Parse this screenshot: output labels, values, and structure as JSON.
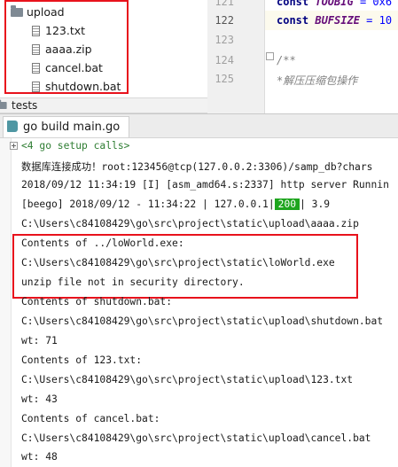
{
  "project_tree": {
    "folder": "upload",
    "files": [
      "123.txt",
      "aaaa.zip",
      "cancel.bat",
      "shutdown.bat"
    ],
    "next_folder": "tests"
  },
  "editor": {
    "lines": [
      {
        "number": "121",
        "keyword": "const",
        "name": "TOOBIG",
        "rest": " = 0x6"
      },
      {
        "number": "122",
        "keyword": "const",
        "name": "BUFSIZE",
        "rest": " = 10"
      },
      {
        "number": "123",
        "text": ""
      },
      {
        "number": "124",
        "comment": "/**"
      },
      {
        "number": "125",
        "comment": "*解压压缩包操作"
      }
    ]
  },
  "run_panel": {
    "tab_label": "go build main.go",
    "folded_calls": "<4 go setup calls>",
    "output": {
      "l1": "数据库连接成功！root:123456@tcp(127.0.0.2:3306)/samp_db?chars",
      "l2": "2018/09/12 11:34:19 [I] [asm_amd64.s:2337] http server Runnin",
      "l3_prefix": "[beego] 2018/09/12 - 11:34:22 |      127.0.0.1|",
      "l3_status": "200",
      "l3_suffix": "|     3.9",
      "l4": "C:\\Users\\c84108429\\go\\src\\project\\static\\upload\\aaaa.zip",
      "l5": "Contents of ../loWorld.exe:",
      "l6": "C:\\Users\\c84108429\\go\\src\\project\\static\\loWorld.exe",
      "l7": "unzip file not in security directory.",
      "l8": "Contents of shutdown.bat:",
      "l9": "C:\\Users\\c84108429\\go\\src\\project\\static\\upload\\shutdown.bat",
      "l10": "wt: 71",
      "l11": "Contents of 123.txt:",
      "l12": "C:\\Users\\c84108429\\go\\src\\project\\static\\upload\\123.txt",
      "l13": "wt: 43",
      "l14": "Contents of cancel.bat:",
      "l15": "C:\\Users\\c84108429\\go\\src\\project\\static\\upload\\cancel.bat",
      "l16": "wt: 48"
    }
  },
  "colors": {
    "highlight_box": "#e8121c",
    "status_ok": "#1ea51e"
  }
}
